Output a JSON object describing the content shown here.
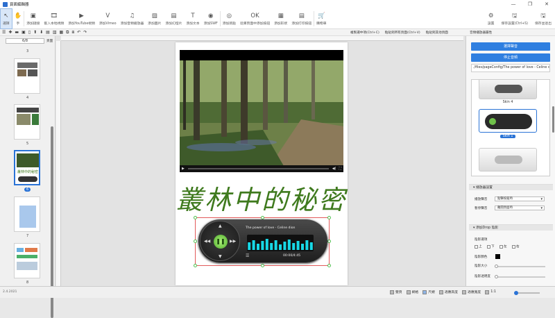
{
  "window": {
    "title": "頁面編輯器",
    "minimize": "—",
    "maximize": "❐",
    "close": "✕"
  },
  "toolbar": [
    {
      "icon": "↖",
      "label": "選擇",
      "active": true
    },
    {
      "icon": "✋",
      "label": "手"
    },
    {
      "icon": "▣",
      "label": "添加鏈接"
    },
    {
      "icon": "🎞",
      "label": "嵌入本地視頻"
    },
    {
      "icon": "▶",
      "label": "添加YouTube視頻"
    },
    {
      "icon": "V",
      "label": "添加Vimeo"
    },
    {
      "icon": "♫",
      "label": "添加音頻播放器"
    },
    {
      "icon": "▨",
      "label": "添加圖片"
    },
    {
      "icon": "▤",
      "label": "添加幻燈片"
    },
    {
      "icon": "T",
      "label": "添加文本"
    },
    {
      "icon": "◉",
      "label": "添加SWF"
    },
    {
      "icon": "◎",
      "label": "添加熱點"
    },
    {
      "icon": "OK",
      "label": "從庫頁面中添加按鈕"
    },
    {
      "icon": "▦",
      "label": "添加形狀"
    },
    {
      "icon": "▤",
      "label": "添加打印按鈕"
    },
    {
      "icon": "🛒",
      "label": "購物車"
    }
  ],
  "toolbar_right": [
    {
      "icon": "⚙",
      "label": "設置"
    },
    {
      "icon": "🖫",
      "label": "保存設置(Ctrl+S)"
    },
    {
      "icon": "🖫",
      "label": "保存並退出"
    }
  ],
  "secondary": {
    "icons": [
      "☰",
      "✚",
      "▬",
      "▣",
      "▯",
      "⬆",
      "⬇",
      "▤",
      "▥",
      "▦",
      "⧉",
      "⧈",
      "↶",
      "↷"
    ],
    "copy": "複製選中項(Ctrl+C)",
    "paste_all": "粘貼到所有頁面(Ctrl+V)",
    "paste_others": "粘貼到其他頁面",
    "right_panel_title": "音頻播放器屬性"
  },
  "pages": {
    "current": "6/8",
    "unit": "頁面",
    "labels": [
      "3",
      "4",
      "5",
      "6",
      "7",
      "8"
    ],
    "thumb_title": "叢林中的秘密"
  },
  "canvas": {
    "heading": "叢林中的秘密",
    "player": {
      "song": "The power of love - Celine dion",
      "time": "00:00/4:45",
      "eq_levels": [
        0.55,
        0.7,
        0.45,
        0.65,
        0.8,
        0.5,
        0.7,
        0.4,
        0.6,
        0.75,
        0.5,
        0.65,
        0.45,
        0.7,
        0.55
      ]
    }
  },
  "properties": {
    "select_audio": "選擇聲音",
    "stop_audio": "停止音頻",
    "audio_path": "./files/pageConfig/The power of love - Celine dion",
    "skins": [
      "Skin 4",
      "Skin 1"
    ],
    "player_settings": "播放器設置",
    "play_sound_label": "播放聲音",
    "play_sound_value": "點擊按鈕時",
    "pause_sound_label": "暫停聲音",
    "pause_sound_value": "離開頁面時",
    "drop_shadow": "添加Drop 陰影",
    "shadow_direction": "陰影選項",
    "directions": [
      "上",
      "下",
      "左",
      "右"
    ],
    "shadow_color": "陰影顏色",
    "shadow_size": "陰影大小",
    "shadow_opacity": "陰影透明度"
  },
  "status": {
    "version": "2.4.2021",
    "items": [
      "雙頁",
      "網格",
      "尺規",
      "適應高度",
      "適應寬度",
      "1:1"
    ]
  },
  "colors": {
    "accent": "#2f7fe0",
    "heading": "#3f7a1e",
    "eq": "#18d8e6"
  }
}
